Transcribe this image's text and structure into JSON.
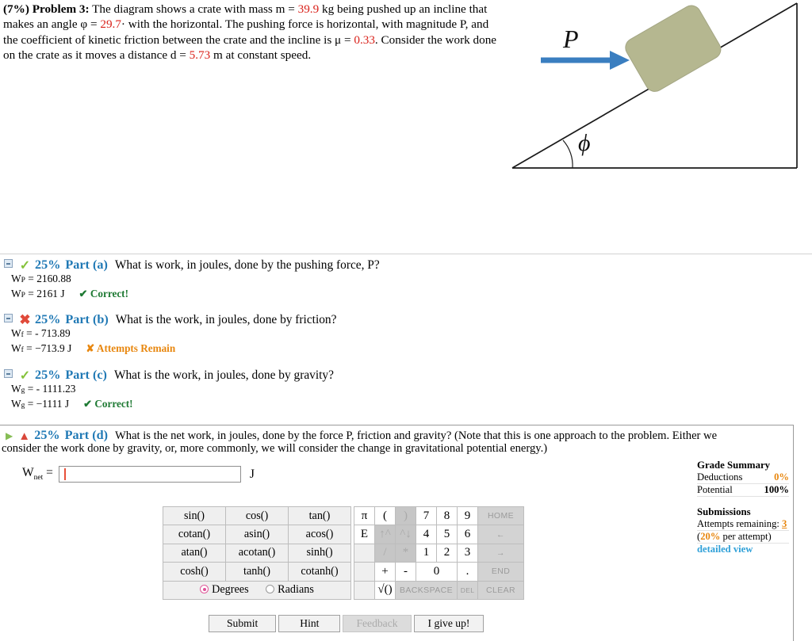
{
  "problem": {
    "weight": "(7%)",
    "title": "Problem 3:",
    "seg1": "The diagram shows a crate with mass m = ",
    "mass": "39.9",
    "seg2": " kg being pushed up an incline that makes an angle φ = ",
    "angle": "29.7",
    "seg3": "· with the horizontal. The pushing force is horizontal, with magnitude P, and the coefficient of kinetic friction between the crate and the incline is μ = ",
    "mu": "0.33",
    "seg4": ". Consider the work done on the crate as it moves a distance d = ",
    "distance": "5.73",
    "seg5": " m at constant speed."
  },
  "diagram": {
    "force_label": "P",
    "angle_label": "ϕ",
    "crate_color": "#b5b790",
    "arrow_color": "#3a7ec0",
    "line_color": "#1a1a1a"
  },
  "parts": [
    {
      "id": "a",
      "percent": "25%",
      "label": "Part (a)",
      "question": "What is work, in joules, done by the pushing force, P?",
      "status": "correct",
      "status_icon": "green-check-icon",
      "toggle_icon": "collapse-box-icon",
      "answer_raw_var": "W",
      "answer_raw_sub": "P",
      "answer_raw": "= 2160.88",
      "answer_final_var": "W",
      "answer_final_sub": "P",
      "answer_final": "= 2161 J",
      "verdict": "✔ Correct!"
    },
    {
      "id": "b",
      "percent": "25%",
      "label": "Part (b)",
      "question": "What is the work, in joules, done by friction?",
      "status": "incorrect",
      "status_icon": "red-x-icon",
      "toggle_icon": "collapse-box-icon",
      "answer_raw_var": "W",
      "answer_raw_sub": "f",
      "answer_raw": "= - 713.89",
      "answer_final_var": "W",
      "answer_final_sub": "f",
      "answer_final": "= −713.9 J",
      "verdict": "✘ Attempts Remain"
    },
    {
      "id": "c",
      "percent": "25%",
      "label": "Part (c)",
      "question": "What is the work, in joules, done by gravity?",
      "status": "correct",
      "status_icon": "green-check-icon",
      "toggle_icon": "collapse-box-icon",
      "answer_raw_var": "W",
      "answer_raw_sub": "g",
      "answer_raw": "= - 1111.23",
      "answer_final_var": "W",
      "answer_final_sub": "g",
      "answer_final": "= −1111 J",
      "verdict": "✔ Correct!"
    }
  ],
  "part_d": {
    "percent": "25%",
    "label": "Part (d)",
    "question_line1": "What is the net work, in joules, done by the force P, friction and gravity? (Note that this is one approach to the problem. Either we",
    "question_line2": "consider the work done by gravity, or, more commonly, we will consider the change in gravitational potential energy.)",
    "expand_icon": "green-play-triangle-icon",
    "warn_icon": "red-warning-triangle-icon",
    "answer_var": "W",
    "answer_sub": "net",
    "answer_eq": "=",
    "input_value": "",
    "input_placeholder": "",
    "unit": "J"
  },
  "grade_summary": {
    "title": "Grade Summary",
    "rows": [
      {
        "label": "Deductions",
        "value": "0%",
        "style": "orange"
      },
      {
        "label": "Potential",
        "value": "100%",
        "style": "bold"
      }
    ],
    "submissions_title": "Submissions",
    "attempts_label": "Attempts remaining:",
    "attempts_value": "3",
    "per_attempt_pct": "20%",
    "per_attempt_text": "per attempt)",
    "per_attempt_open": "(",
    "detailed_view": "detailed view"
  },
  "keypad": {
    "functions": [
      [
        "sin()",
        "cos()",
        "tan()"
      ],
      [
        "cotan()",
        "asin()",
        "acos()"
      ],
      [
        "atan()",
        "acotan()",
        "sinh()"
      ],
      [
        "cosh()",
        "tanh()",
        "cotanh()"
      ]
    ],
    "degrees_label": "Degrees",
    "radians_label": "Radians",
    "angle_mode": "Degrees",
    "r1": {
      "pi": "π",
      "lparen": "(",
      "rparen": ")",
      "d7": "7",
      "d8": "8",
      "d9": "9",
      "home": "HOME"
    },
    "r2": {
      "e": "E",
      "up": "↑^",
      "down": "^↓",
      "d4": "4",
      "d5": "5",
      "d6": "6",
      "left": "←"
    },
    "r3": {
      "blank": "",
      "div": "/",
      "mul": "*",
      "d1": "1",
      "d2": "2",
      "d3": "3",
      "right": "→"
    },
    "r4": {
      "blank": "",
      "plus": "+",
      "minus": "-",
      "zero": "0",
      "dot": ".",
      "end": "END"
    },
    "r5": {
      "blank": "",
      "sqrt": "√()",
      "backspace": "BACKSPACE",
      "del": "DEL",
      "clear": "CLEAR"
    }
  },
  "actions": {
    "submit": "Submit",
    "hint": "Hint",
    "feedback": "Feedback",
    "give_up": "I give up!"
  }
}
